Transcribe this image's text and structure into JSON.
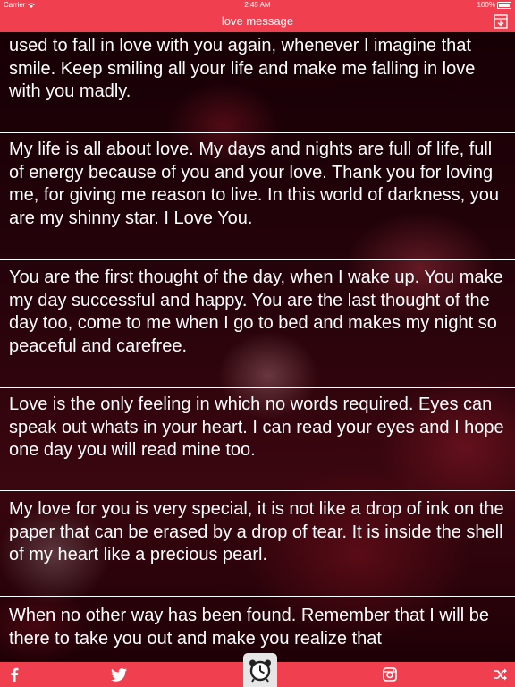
{
  "status_bar": {
    "carrier": "Carrier",
    "time": "2:45 AM",
    "battery": "100%",
    "battery_level": 1.0
  },
  "nav": {
    "title": "love message",
    "right_icon": "download-icon"
  },
  "messages": [
    {
      "text": "used to fall in love with you again, whenever I imagine that smile. Keep smiling all your life and make me falling in love with you madly."
    },
    {
      "text": "My life is all about love. My days and nights are full of life, full of energy because of you and your love. Thank you for loving me, for giving me reason to live. In this world of darkness, you are my shinny star. I Love You."
    },
    {
      "text": "You are the first thought of the day, when I wake up. You make my day successful and happy. You are the last thought of the day too, come to me when I go to bed and makes my night so peaceful and carefree."
    },
    {
      "text": "Love is the only feeling in which no words required. Eyes can speak out whats in your heart. I can read your eyes and I hope one day you will  read mine too."
    },
    {
      "text": "My love for you is very special, it is not like a drop of ink on the paper that can be erased by a drop of tear. It is inside the shell of my heart like a precious pearl."
    },
    {
      "text": "When no other way has been found. Remember that I will be there to take you out and make you realize that"
    }
  ],
  "tab_bar": {
    "items": [
      {
        "icon": "facebook-icon"
      },
      {
        "icon": "twitter-icon"
      },
      {
        "icon": "alarm-clock-icon"
      },
      {
        "icon": "instagram-icon"
      },
      {
        "icon": "shuffle-icon"
      }
    ]
  },
  "colors": {
    "accent": "#f0404f",
    "text": "#ffffff"
  }
}
